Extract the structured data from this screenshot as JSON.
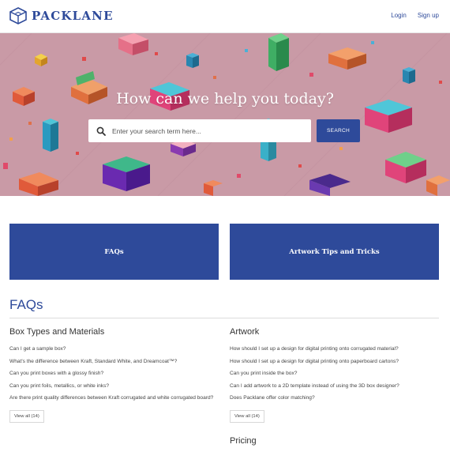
{
  "header": {
    "brand": "PACKLANE",
    "logo_icon": "box-logo-icon",
    "login_label": "Login",
    "signup_label": "Sign up"
  },
  "hero": {
    "title": "How can we help you today?",
    "search_placeholder": "Enter your search term here...",
    "search_button": "SEARCH",
    "search_icon": "search-icon"
  },
  "categories": [
    "FAQs",
    "Artwork Tips and Tricks"
  ],
  "faq": {
    "heading": "FAQs",
    "sections": [
      {
        "title": "Box Types and Materials",
        "questions": [
          "Can I get a sample box?",
          "What's the difference between Kraft, Standard White, and Dreamcoat™?",
          "Can you print boxes with a glossy finish?",
          "Can you print foils, metallics, or white inks?",
          "Are there print quality differences between Kraft corrugated and white corrugated board?"
        ],
        "view_all": "View all (14)"
      },
      {
        "title": "Artwork",
        "questions": [
          "How should I set up a design for digital printing onto corrugated material?",
          "How should I set up a design for digital printing onto paperboard cartons?",
          "Can you print inside the box?",
          "Can I add artwork to a 2D template instead of using the 3D box designer?",
          "Does Packlane offer color matching?"
        ],
        "view_all": "View all (14)"
      },
      {
        "title": "Pricing"
      }
    ]
  },
  "colors": {
    "brand": "#2e4a9a",
    "hero_background": "#c99aa6"
  }
}
